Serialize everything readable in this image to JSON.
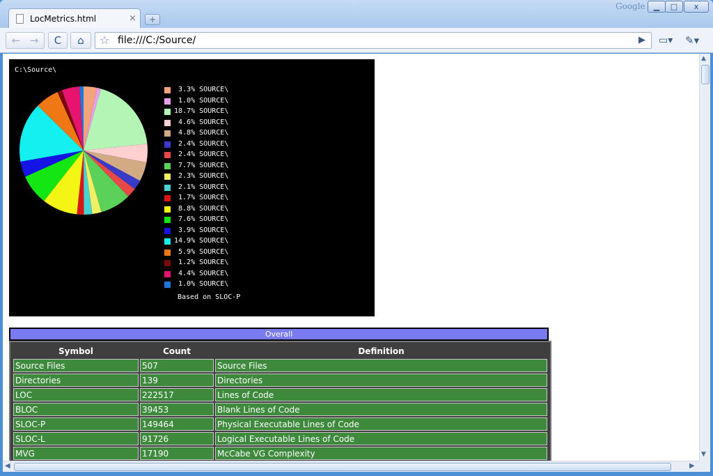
{
  "window": {
    "brand": "Google",
    "min_glyph": "▁",
    "max_glyph": "□",
    "close_glyph": "x"
  },
  "tab": {
    "title": "LocMetrics.html",
    "close_glyph": "×",
    "new_tab_glyph": "+"
  },
  "toolbar": {
    "back_glyph": "←",
    "forward_glyph": "→",
    "reload_glyph": "C",
    "home_glyph": "⌂",
    "star_glyph": "☆",
    "url": "file:///C:/Source/",
    "go_glyph": "▶",
    "page_glyph": "▭▾",
    "wrench_glyph": "✎▾"
  },
  "chart_data": {
    "type": "pie",
    "title": "C:\\Source\\",
    "footnote": "Based on SLOC-P",
    "slices": [
      {
        "label": "SOURCE\\",
        "percent": 3.3,
        "text": " 3.3%",
        "color": "#f4a37a"
      },
      {
        "label": "SOURCE\\",
        "percent": 1.0,
        "text": " 1.0%",
        "color": "#e89ee8"
      },
      {
        "label": "SOURCE\\",
        "percent": 18.7,
        "text": "18.7%",
        "color": "#b4f4b4"
      },
      {
        "label": "SOURCE\\",
        "percent": 4.6,
        "text": " 4.6%",
        "color": "#ffd0d0"
      },
      {
        "label": "SOURCE\\",
        "percent": 4.8,
        "text": " 4.8%",
        "color": "#d2aa84"
      },
      {
        "label": "SOURCE\\",
        "percent": 2.4,
        "text": " 2.4%",
        "color": "#3a3ac8"
      },
      {
        "label": "SOURCE\\",
        "percent": 2.4,
        "text": " 2.4%",
        "color": "#e84848"
      },
      {
        "label": "SOURCE\\",
        "percent": 7.7,
        "text": " 7.7%",
        "color": "#5ad25a"
      },
      {
        "label": "SOURCE\\",
        "percent": 2.3,
        "text": " 2.3%",
        "color": "#f0f064"
      },
      {
        "label": "SOURCE\\",
        "percent": 2.1,
        "text": " 2.1%",
        "color": "#48d2d2"
      },
      {
        "label": "SOURCE\\",
        "percent": 1.7,
        "text": " 1.7%",
        "color": "#dc1414"
      },
      {
        "label": "SOURCE\\",
        "percent": 8.8,
        "text": " 8.8%",
        "color": "#f5f514"
      },
      {
        "label": "SOURCE\\",
        "percent": 7.6,
        "text": " 7.6%",
        "color": "#14e614"
      },
      {
        "label": "SOURCE\\",
        "percent": 3.9,
        "text": " 3.9%",
        "color": "#1414e6"
      },
      {
        "label": "SOURCE\\",
        "percent": 14.9,
        "text": "14.9%",
        "color": "#14f0f0"
      },
      {
        "label": "SOURCE\\",
        "percent": 5.9,
        "text": " 5.9%",
        "color": "#f07814"
      },
      {
        "label": "SOURCE\\",
        "percent": 1.2,
        "text": " 1.2%",
        "color": "#780a0a"
      },
      {
        "label": "SOURCE\\",
        "percent": 4.4,
        "text": " 4.4%",
        "color": "#e6146e"
      },
      {
        "label": "SOURCE\\",
        "percent": 1.0,
        "text": " 1.0%",
        "color": "#1e78dc"
      }
    ]
  },
  "table": {
    "caption": "Overall",
    "headers": [
      "Symbol",
      "Count",
      "Definition"
    ],
    "rows": [
      [
        "Source Files",
        "507",
        "Source Files"
      ],
      [
        "Directories",
        "139",
        "Directories"
      ],
      [
        "LOC",
        "222517",
        "Lines of Code"
      ],
      [
        "BLOC",
        "39453",
        "Blank Lines of Code"
      ],
      [
        "SLOC-P",
        "149464",
        "Physical Executable Lines of Code"
      ],
      [
        "SLOC-L",
        "91726",
        "Logical Executable Lines of Code"
      ],
      [
        "MVG",
        "17190",
        "McCabe VG Complexity"
      ]
    ]
  },
  "scrollbars": {
    "up_glyph": "▲",
    "down_glyph": "▼",
    "left_glyph": "◀",
    "right_glyph": "▶"
  }
}
